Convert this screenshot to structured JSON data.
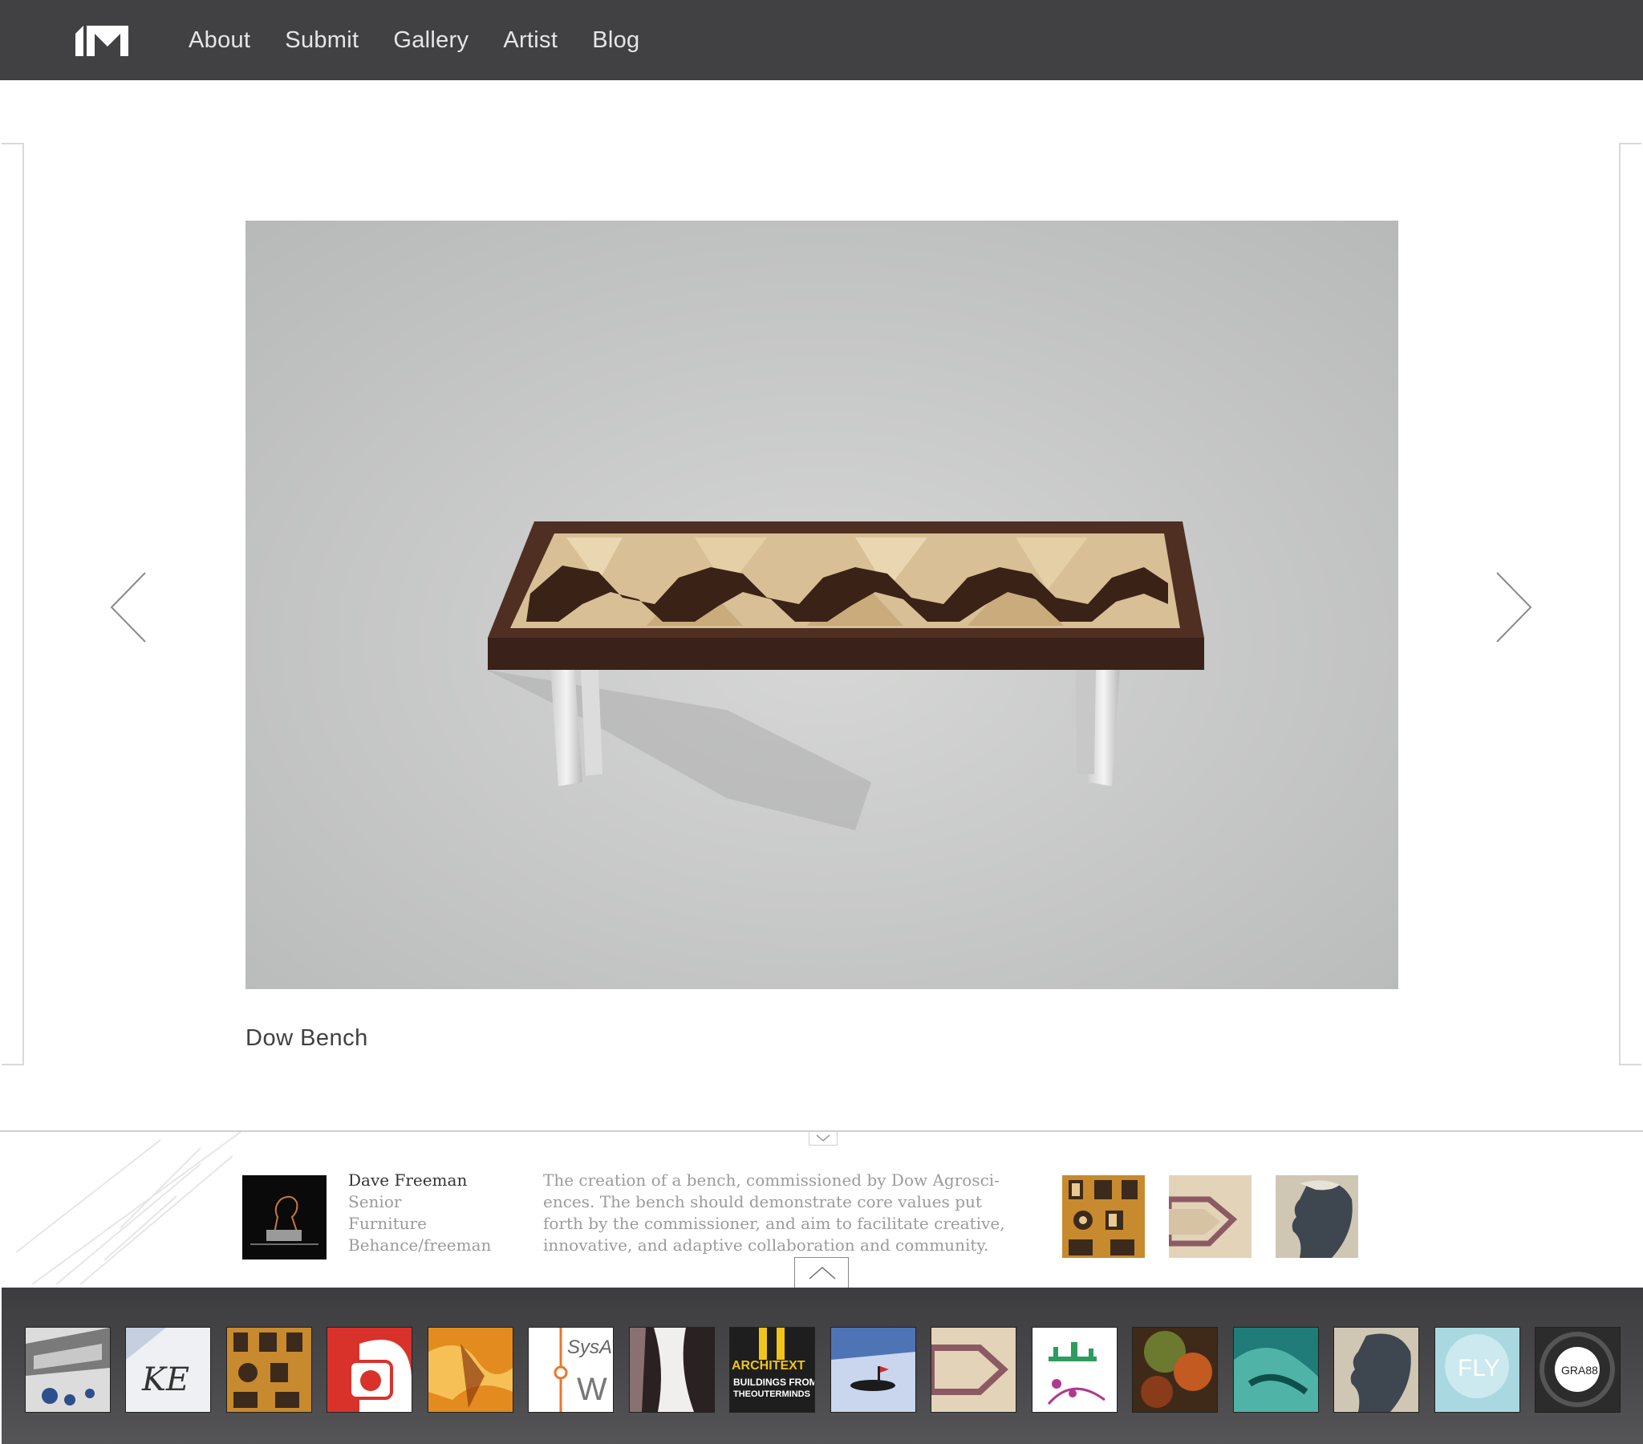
{
  "nav": {
    "logo_icon": "im-logo-icon",
    "items": [
      "About",
      "Submit",
      "Gallery",
      "Artist",
      "Blog"
    ]
  },
  "artwork": {
    "title": "Dow Bench",
    "prev_icon": "chevron-left-icon",
    "next_icon": "chevron-right-icon"
  },
  "artist": {
    "name": "Dave Freeman",
    "year": "Senior",
    "discipline": "Furniture",
    "link": "Behance/freeman"
  },
  "description": "The creation of a bench, commissioned by Dow Agrosci-ences. The bench should demonstrate core values put forth by the commissioner, and aim to facilitate creative, innovative, and adaptive collaboration and community.",
  "related_count": 3,
  "strip_text": {
    "kE": "KE",
    "sysa": "SysA",
    "w": "W",
    "architext": "ARCHITEXT",
    "buildings": "BUILDINGS FROM",
    "outerminds": "THEOUTERMINDS",
    "fly": "FLY",
    "gra": "GRA88"
  },
  "colors": {
    "topbar": "#414042",
    "nav_text": "#e6e6e6",
    "caption": "#414042",
    "muted_text": "#9b9b9b",
    "strip": "#4a494b"
  }
}
